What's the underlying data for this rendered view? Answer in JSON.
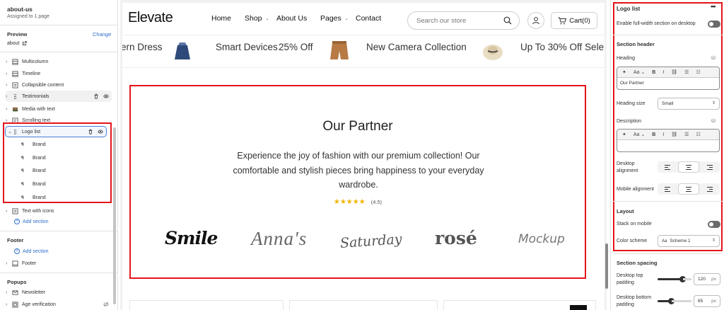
{
  "left_panel": {
    "title": "about-us",
    "subtitle": "Assigned to 1 page",
    "preview_label": "Preview",
    "change_label": "Change",
    "preview_page": "about",
    "items": [
      {
        "label": "Multicolumn"
      },
      {
        "label": "Timeline"
      },
      {
        "label": "Collapsible content"
      },
      {
        "label": "Testimonials"
      },
      {
        "label": "Media with text"
      },
      {
        "label": "Scrolling text"
      },
      {
        "label": "Logo list"
      }
    ],
    "brands": [
      "Brand",
      "Brand",
      "Brand",
      "Brand",
      "Brand"
    ],
    "text_with_icons": "Text with icons",
    "add_section": "Add section",
    "footer_heading": "Footer",
    "footer_add_section": "Add section",
    "footer_item": "Footer",
    "popups_heading": "Popups",
    "popups_items": [
      {
        "label": "Newsletter"
      },
      {
        "label": "Age verification"
      }
    ]
  },
  "store": {
    "logo": "Elevate",
    "nav": [
      {
        "label": "Home"
      },
      {
        "label": "Shop"
      },
      {
        "label": "About Us"
      },
      {
        "label": "Pages"
      },
      {
        "label": "Contact"
      }
    ],
    "search_placeholder": "Search our store",
    "cart_label": "Cart(0)",
    "marquee": [
      "ern Dress",
      "Smart Devices",
      "25% Off",
      "New Camera Collection",
      "Up To 30% Off Sele"
    ],
    "section": {
      "title": "Our Partner",
      "description": "Experience the joy of fashion with our premium collection! Our comfortable and stylish pieces bring happiness to your everyday wardrobe.",
      "stars": "★★★★★",
      "rating": "(4.5)",
      "rating_value": 4.5,
      "brand_logos": [
        "Smile",
        "Anna's",
        "Saturday",
        "rosé",
        "Mockup"
      ]
    }
  },
  "right_panel": {
    "title": "Logo list",
    "more": "•••",
    "full_width_label": "Enable full-width section on desktop",
    "section_header": "Section header",
    "heading_label": "Heading",
    "heading_value": "Our Partner",
    "heading_size_label": "Heading size",
    "heading_size_value": "Small",
    "description_label": "Description",
    "desktop_alignment_label": "Desktop alignment",
    "mobile_alignment_label": "Mobile alignment",
    "layout_heading": "Layout",
    "stack_mobile_label": "Stack on mobile",
    "color_scheme_label": "Color scheme",
    "color_scheme_value": "Scheme 1",
    "spacing_heading": "Section spacing",
    "top_padding_label": "Desktop top padding",
    "top_padding_value": "120",
    "bottom_padding_label": "Desktop bottom padding",
    "bottom_padding_value": "65",
    "unit": "px",
    "toolbar_font": "Aa",
    "toolbar_bold": "B",
    "toolbar_italic": "I"
  }
}
